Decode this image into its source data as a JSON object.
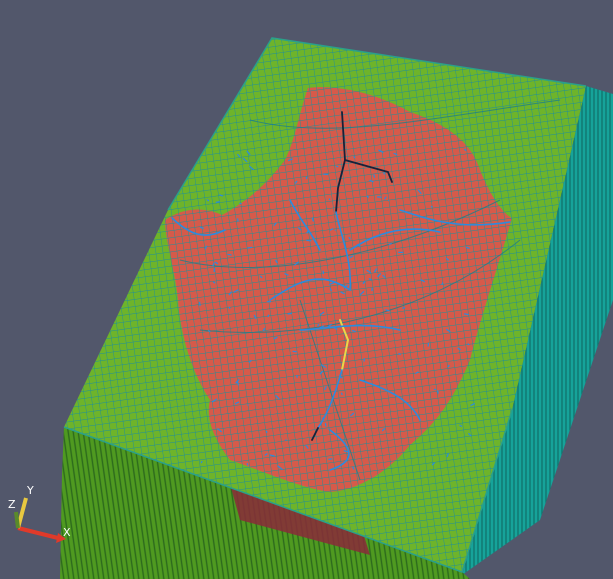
{
  "viewport": {
    "background": "#52576b"
  },
  "colors": {
    "top_surface": "#6eb42a",
    "river_region": "#d65a4a",
    "mesh_line": "#1f8f9a",
    "side_wall": "#16a39a",
    "side_wall_dark": "#2f7a2a",
    "front_wall": "#4f9a20",
    "front_red_band": "#8a2a3a",
    "stream_blue": "#2a8ce0",
    "stream_dark": "#15223a",
    "stream_yellow": "#e8d84a"
  },
  "axes": {
    "x_label": "X",
    "y_label": "Y",
    "z_label": "Z",
    "x_color": "#e03a2a",
    "y_color": "#e8c840",
    "z_color": "#5a8a2a"
  }
}
